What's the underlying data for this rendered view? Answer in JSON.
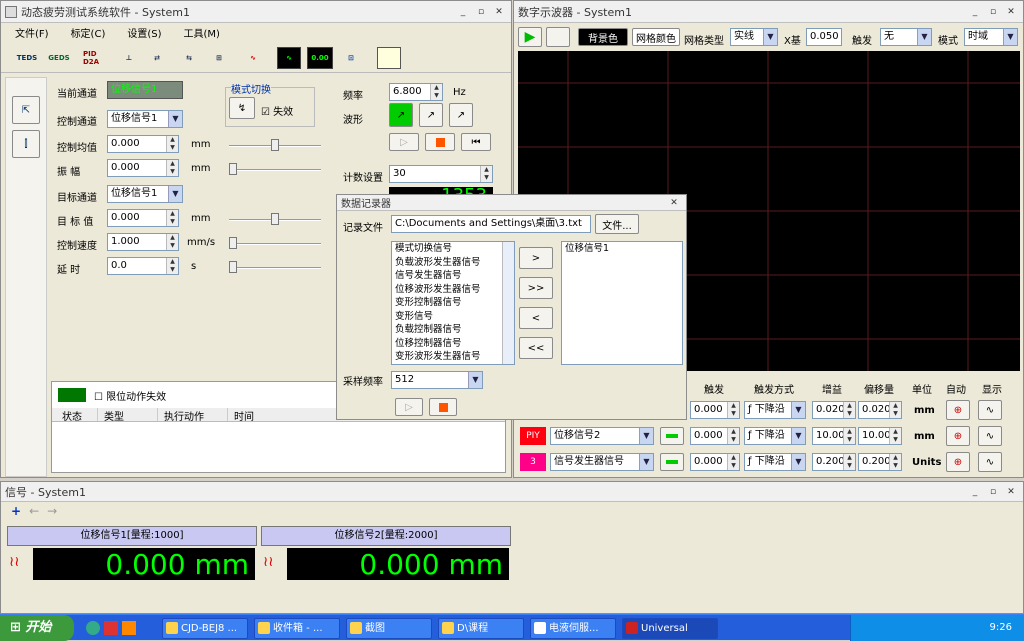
{
  "left_window": {
    "title": "动态疲劳测试系统软件 - System1",
    "menu": [
      "文件(F)",
      "标定(C)",
      "设置(S)",
      "工具(M)"
    ],
    "toolbar_icons": [
      "TEDS",
      "GEDS",
      "PID D2A",
      "sensor",
      "filter",
      "link",
      "pump",
      "wave",
      "scope",
      "0.00",
      "network",
      "split"
    ],
    "current_channel_label": "当前通道",
    "current_channel_value": "位移信号1",
    "control_channel_label": "控制通道",
    "control_channel_value": "位移信号1",
    "control_value_label": "控制均值",
    "control_value": "0.000",
    "control_value_unit": "mm",
    "amplitude_label": "振   幅",
    "amplitude_value": "0.000",
    "amplitude_unit": "mm",
    "target_channel_label": "目标通道",
    "target_channel_value": "位移信号1",
    "target_value_label": "目 标 值",
    "target_value": "0.000",
    "target_value_unit": "mm",
    "control_speed_label": "控制速度",
    "control_speed_value": "1.000",
    "control_speed_unit": "mm/s",
    "delay_label": "延    时",
    "delay_value": "0.0",
    "delay_unit": "s",
    "mode_group": "模式切换",
    "mode_check": "失效",
    "freq_label": "频率",
    "freq_value": "6.800",
    "freq_unit": "Hz",
    "wave_label": "波形",
    "count_label": "计数设置",
    "count_value": "30",
    "count_display": "1353",
    "limit_label": "限位动作失效",
    "table_headers": [
      "状态",
      "类型",
      "执行动作",
      "时间"
    ]
  },
  "scope": {
    "title": "数字示波器 - System1",
    "bg_btn": "背景色",
    "grid_btn": "网格颜色",
    "grid_type_label": "网格类型",
    "grid_type_value": "实线",
    "x_label": "X基",
    "x_value": "0.050",
    "trigger_label": "触发",
    "trigger_value": "无",
    "mode_label": "模式",
    "mode_value": "时域",
    "table_headers": [
      "触发",
      "触发方式",
      "增益",
      "偏移量",
      "单位",
      "自动",
      "显示"
    ],
    "rows": [
      {
        "tag": "",
        "channel": "",
        "trigger": "0.000",
        "mode": "下降沿",
        "gain": "0.020",
        "offset": "0.020",
        "unit": "mm"
      },
      {
        "tag": "PIY",
        "channel": "位移信号2",
        "trigger": "0.000",
        "mode": "下降沿",
        "gain": "10.000",
        "offset": "10.000",
        "unit": "mm"
      },
      {
        "tag": "3",
        "channel": "信号发生器信号",
        "trigger": "0.000",
        "mode": "下降沿",
        "gain": "0.200",
        "offset": "0.200",
        "unit": "Units"
      }
    ]
  },
  "dialog": {
    "title": "数据记录器",
    "file_label": "记录文件",
    "file_value": "C:\\Documents and Settings\\桌面\\3.txt",
    "file_btn": "文件...",
    "source_items": [
      "模式切换信号",
      "负载波形发生器信号",
      "信号发生器信号",
      "位移波形发生器信号",
      "变形控制器信号",
      "变形信号",
      "负载控制器信号",
      "位移控制器信号",
      "变形波形发生器信号"
    ],
    "buttons": [
      ">",
      ">>",
      "<",
      "<<"
    ],
    "selected_items": [
      "位移信号1"
    ],
    "rate_label": "采样频率",
    "rate_value": "512"
  },
  "signals": {
    "title": "信号 - System1",
    "cards": [
      {
        "header": "位移信号1[量程:1000]",
        "value": "0.000 mm"
      },
      {
        "header": "位移信号2[量程:2000]",
        "value": "0.000 mm"
      }
    ]
  },
  "taskbar": {
    "start": "开始",
    "items": [
      "CJD-BEJ8 ...",
      "收件箱 - ...",
      "截图",
      "D\\课程",
      "电液伺服...",
      "Universal"
    ],
    "clock": "9:26"
  }
}
